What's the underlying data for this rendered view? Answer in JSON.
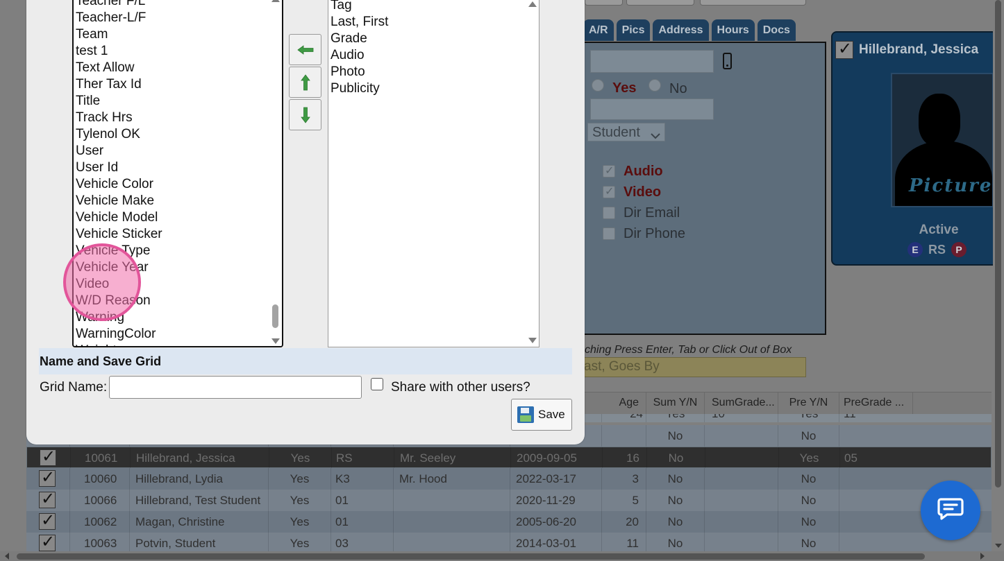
{
  "background": {
    "tabs": [
      "A/R",
      "Pics",
      "Address",
      "Hours",
      "Docs"
    ],
    "detail": {
      "yes_label": "Yes",
      "no_label": "No",
      "role_select": "Student",
      "checkboxes": [
        {
          "label": "Audio",
          "checked": true,
          "emphasis": true
        },
        {
          "label": "Video",
          "checked": true,
          "emphasis": true
        },
        {
          "label": "Dir Email",
          "checked": false,
          "emphasis": false
        },
        {
          "label": "Dir Phone",
          "checked": false,
          "emphasis": false
        }
      ]
    },
    "profile": {
      "name": "Hillebrand, Jessica",
      "photo_placeholder": "Picture",
      "status": "Active",
      "badge_e": "E",
      "badge_rs": "RS",
      "badge_p": "P"
    },
    "search_hint": "ching Press Enter, Tab or Click Out of Box",
    "search_placeholder": "ast, Goes By",
    "grid": {
      "headers": [
        "Age",
        "Sum Y/N",
        "SumGrade...",
        "Pre Y/N",
        "PreGrade ..."
      ],
      "partial_row": [
        "24",
        "Yes",
        "10",
        "Yes",
        "11"
      ],
      "rows": [
        {
          "id": "",
          "name": "",
          "active": "",
          "grade": "",
          "teacher": "",
          "dob": "",
          "age": "",
          "sum": "No",
          "sumgrade": "",
          "pre": "No",
          "pregrade": "",
          "checked": false
        },
        {
          "id": "10061",
          "name": "Hillebrand, Jessica",
          "active": "Yes",
          "grade": "RS",
          "teacher": "Mr. Seeley",
          "dob": "2009-09-05",
          "age": "16",
          "sum": "No",
          "sumgrade": "",
          "pre": "Yes",
          "pregrade": "05",
          "checked": true
        },
        {
          "id": "10060",
          "name": "Hillebrand, Lydia",
          "active": "Yes",
          "grade": "K3",
          "teacher": "Mr. Hood",
          "dob": "2022-03-17",
          "age": "3",
          "sum": "No",
          "sumgrade": "",
          "pre": "No",
          "pregrade": "",
          "checked": true
        },
        {
          "id": "10066",
          "name": "Hillebrand, Test Student",
          "active": "Yes",
          "grade": "01",
          "teacher": "",
          "dob": "2020-11-29",
          "age": "5",
          "sum": "No",
          "sumgrade": "",
          "pre": "No",
          "pregrade": "",
          "checked": true
        },
        {
          "id": "10062",
          "name": "Magan, Christine",
          "active": "Yes",
          "grade": "01",
          "teacher": "",
          "dob": "2005-06-20",
          "age": "20",
          "sum": "No",
          "sumgrade": "",
          "pre": "No",
          "pregrade": "",
          "checked": true
        },
        {
          "id": "10063",
          "name": "Potvin, Student",
          "active": "Yes",
          "grade": "03",
          "teacher": "",
          "dob": "2014-03-01",
          "age": "11",
          "sum": "No",
          "sumgrade": "",
          "pre": "No",
          "pregrade": "",
          "checked": true
        }
      ]
    }
  },
  "dialog": {
    "available_fields": [
      "Teacher F/L",
      "Teacher-L/F",
      "Team",
      "test 1",
      "Text Allow",
      "Ther Tax Id",
      "Title",
      "Track Hrs",
      "Tylenol OK",
      "User",
      "User Id",
      "Vehicle Color",
      "Vehicle Make",
      "Vehicle Model",
      "Vehicle Sticker",
      "Vehicle Type",
      "Vehicle Year",
      "Video",
      "W/D Reason",
      "Warning",
      "WarningColor",
      "Weight"
    ],
    "selected_fields": [
      "Tag",
      "Last, First",
      "Grade",
      "Audio",
      "Photo",
      "Publicity"
    ],
    "section_title": "Name and Save Grid",
    "grid_name_label": "Grid Name:",
    "grid_name_value": "",
    "share_label": "Share with other users?",
    "share_checked": false,
    "save_label": "Save"
  },
  "colors": {
    "accent_blue": "#1d6ad2",
    "highlight_pink": "#e2559a",
    "move_arrow_green": "#3f9a44"
  }
}
